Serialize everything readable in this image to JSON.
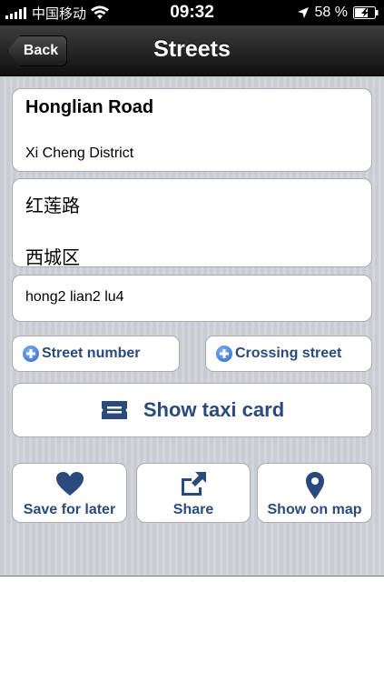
{
  "status_bar": {
    "carrier": "中国移动",
    "time": "09:32",
    "battery": "58 %"
  },
  "nav": {
    "back_label": "Back",
    "title": "Streets"
  },
  "street": {
    "name": "Honglian Road",
    "district": "Xi Cheng District",
    "name_cn": "红莲路",
    "district_cn": "西城区",
    "pinyin": "hong2 lian2 lu4"
  },
  "buttons": {
    "street_number": "Street number",
    "crossing_street": "Crossing street",
    "taxi_card": "Show taxi card",
    "save": "Save for later",
    "share": "Share",
    "map": "Show on map"
  },
  "icons": {
    "signal": "signal-bars-icon",
    "wifi": "wifi-icon",
    "location": "location-arrow-icon",
    "battery": "battery-charging-icon",
    "plus": "plus-circle-icon",
    "taxi": "taxi-card-icon",
    "heart": "heart-icon",
    "share": "share-icon",
    "map_pin": "map-pin-icon"
  },
  "colors": {
    "accent": "#2a4a7e",
    "plus_blue": "#2d69c8",
    "nav_bg": "#1c1c1c",
    "content_bg": "#cdd0d7"
  }
}
